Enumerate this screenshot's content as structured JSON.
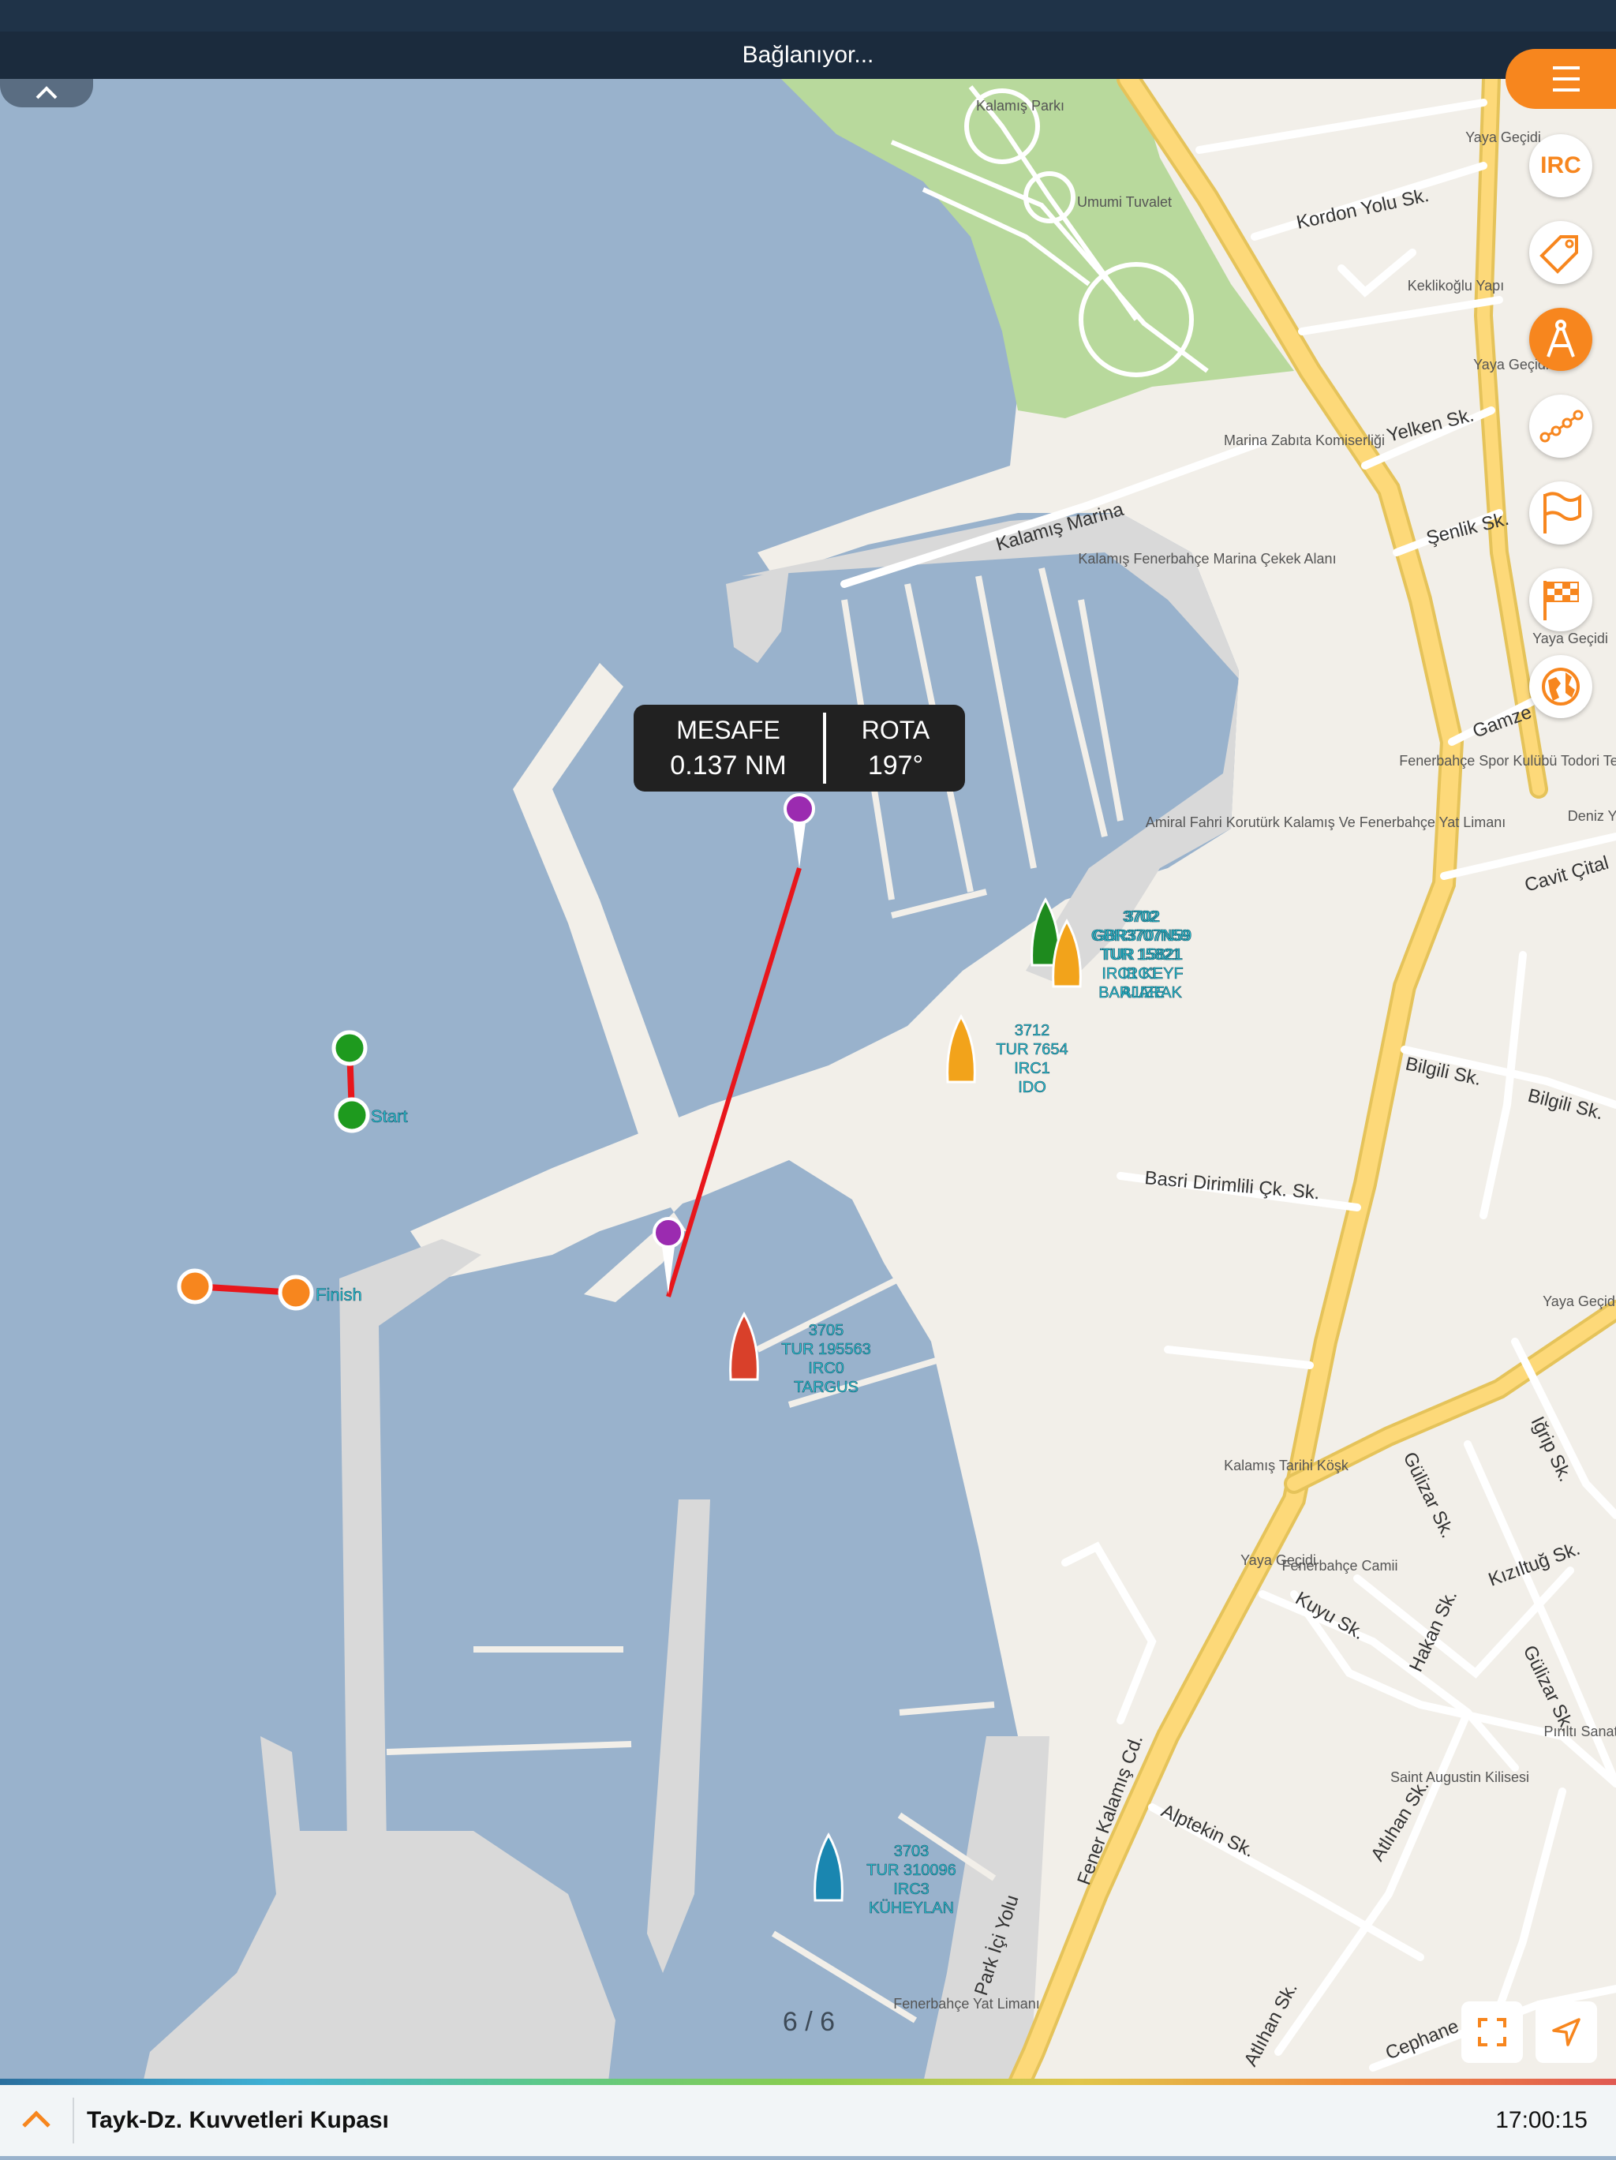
{
  "status": {
    "connection": "Bağlanıyor..."
  },
  "race": {
    "title": "Tayk-Dz. Kuvvetleri Kupası",
    "time": "17:00:15"
  },
  "measure": {
    "distance_label": "MESAFE",
    "distance_value": "0.137 NM",
    "course_label": "ROTA",
    "course_value": "197°"
  },
  "pager": {
    "text": "6 / 6"
  },
  "side_buttons": {
    "irc": "IRC"
  },
  "marks": {
    "start": "Start",
    "finish": "Finish"
  },
  "boats": [
    {
      "color": "#1e8a1e",
      "lines": [
        "3702",
        "GBR3707N59",
        "TUR 15821",
        "IRC1",
        "BARJARAK"
      ]
    },
    {
      "color": "#f2a31b",
      "lines": [
        "3702",
        "GBR3707N59",
        "TUR 15821",
        "IRC1 KEYF",
        "ALIZE"
      ]
    },
    {
      "color": "#f2a31b",
      "lines": [
        "3712",
        "TUR 7654",
        "IRC1",
        "IDO"
      ]
    },
    {
      "color": "#d9402a",
      "lines": [
        "3705",
        "TUR 195563",
        "IRC0",
        "TARGUS"
      ]
    },
    {
      "color": "#1a86b0",
      "lines": [
        "3703",
        "TUR 310096",
        "IRC3",
        "KÜHEYLAN"
      ]
    }
  ],
  "streets": [
    "Kordon Yolu Sk.",
    "Yelken Sk.",
    "Şenlik Sk.",
    "Kalamış Marina",
    "Gamze",
    "Cavit Çital",
    "Bilgili Sk.",
    "Bilgili Sk.",
    "Basri Dirimlili Çk. Sk.",
    "Gülizar Sk.",
    "Iğrip Sk.",
    "Kızıltuğ Sk.",
    "Hakan Sk.",
    "Kuyu Sk.",
    "Gülizar Sk.",
    "Alptekin Sk.",
    "Atlıhan Sk.",
    "Fener Kalamış Cd.",
    "Park İçi Yolu",
    "Atlıhan Sk.",
    "Cephane Sk."
  ],
  "pois": [
    "Kalamış Parkı",
    "Umumi Tuvalet",
    "Yaya Geçidi",
    "Keklikoğlu Yapı",
    "Yaya Geçidi",
    "Marina Zabıta Komiserliği",
    "Kalamış Fenerbahçe Marina Çekek Alanı",
    "Yaya Geçidi",
    "Fenerbahçe Spor Kulübü Todori Tesisleri",
    "Deniz Yapı",
    "Amiral Fahri Korutürk Kalamış Ve Fenerbahçe Yat Limanı",
    "Yaya Geçidi",
    "Kalamış Tarihi Köşk",
    "Yaya Geçidi",
    "Fenerbahçe Camii",
    "Saint Augustin Kilisesi",
    "Pırıltı Sanat Galeri",
    "Fenerbahçe Yat Limanı"
  ],
  "colors": {
    "accent": "#f7861e",
    "water": "#99b2cc",
    "land": "#f2efe9",
    "park": "#b8d99c",
    "road": "#fdd979",
    "measure_line": "#e8161b",
    "start_mark": "#1e9a1e",
    "finish_mark": "#f7861e"
  },
  "icons": [
    "menu-icon",
    "tag-icon",
    "compass-icon",
    "route-icon",
    "flag-icon",
    "checkered-flag-icon",
    "globe-icon",
    "fullscreen-icon",
    "navigation-arrow-icon",
    "chevron-up-icon"
  ]
}
